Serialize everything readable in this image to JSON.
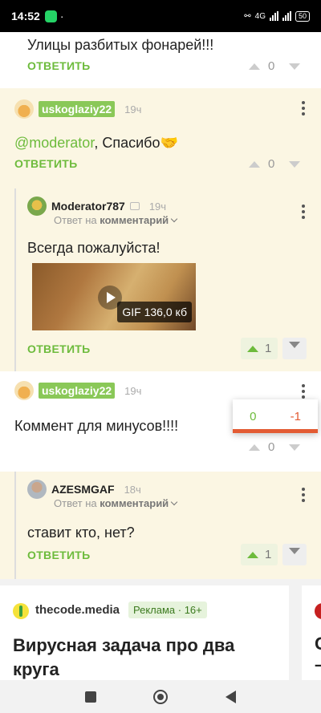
{
  "status_bar": {
    "time": "14:52",
    "network": "4G",
    "battery": "50"
  },
  "comments": [
    {
      "text": "Улицы разбитых фонарей!!!",
      "reply_label": "ОТВЕТИТЬ",
      "rating": "0"
    },
    {
      "author": "uskoglaziy22",
      "time": "19ч",
      "mention": "@moderator",
      "text_after_mention": ", Спасибо",
      "reply_label": "ОТВЕТИТЬ",
      "rating": "0"
    },
    {
      "author": "Moderator787",
      "time": "19ч",
      "reply_to_prefix": "Ответ на",
      "reply_to_link": "комментарий",
      "text": "Всегда пожалуйста!",
      "gif_label": "GIF 136,0 кб",
      "reply_label": "ОТВЕТИТЬ",
      "rating": "1"
    },
    {
      "author": "uskoglaziy22",
      "time": "19ч",
      "text": "Коммент для минусов!!!!",
      "rating": "0",
      "popup_plus": "0",
      "popup_minus": "-1"
    },
    {
      "author": "AZESMGAF",
      "time": "18ч",
      "reply_to_prefix": "Ответ на",
      "reply_to_link": "комментарий",
      "text": "ставит кто, нет?",
      "reply_label": "ОТВЕТИТЬ",
      "rating": "1"
    }
  ],
  "ad": {
    "source": "thecode.media",
    "badge": "Реклама · 16+",
    "headline": "Вирусная задача про два круга",
    "next_card_fragment": "С –"
  },
  "colors": {
    "accent_green": "#6dbb3c",
    "minus_red": "#e35b33",
    "highlight_bg": "#fbf6e3"
  }
}
